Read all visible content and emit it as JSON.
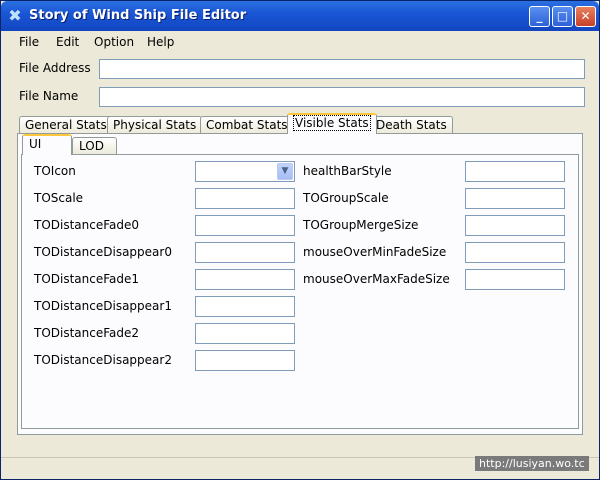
{
  "window": {
    "title": "Story of Wind Ship File Editor",
    "icon": "x-logo-icon",
    "buttons": {
      "minimize": "_",
      "maximize": "□",
      "close": "✕"
    }
  },
  "menu": {
    "items": [
      "File",
      "Edit",
      "Option",
      "Help"
    ]
  },
  "file": {
    "address_label": "File Address",
    "address_value": "",
    "name_label": "File Name",
    "name_value": ""
  },
  "tabs": [
    {
      "label": "General Stats",
      "active": false
    },
    {
      "label": "Physical Stats",
      "active": false
    },
    {
      "label": "Combat Stats",
      "active": false
    },
    {
      "label": "Visible Stats",
      "active": true
    },
    {
      "label": "Death Stats",
      "active": false
    }
  ],
  "subtabs": [
    {
      "label": "UI",
      "active": true
    },
    {
      "label": "LOD",
      "active": false
    }
  ],
  "left_fields": [
    {
      "label": "TOIcon",
      "value": "",
      "type": "combo"
    },
    {
      "label": "TOScale",
      "value": ""
    },
    {
      "label": "TODistanceFade0",
      "value": ""
    },
    {
      "label": "TODistanceDisappear0",
      "value": ""
    },
    {
      "label": "TODistanceFade1",
      "value": ""
    },
    {
      "label": "TODistanceDisappear1",
      "value": ""
    },
    {
      "label": "TODistanceFade2",
      "value": ""
    },
    {
      "label": "TODistanceDisappear2",
      "value": ""
    }
  ],
  "right_fields": [
    {
      "label": "healthBarStyle",
      "value": ""
    },
    {
      "label": "TOGroupScale",
      "value": ""
    },
    {
      "label": "TOGroupMergeSize",
      "value": ""
    },
    {
      "label": "mouseOverMinFadeSize",
      "value": ""
    },
    {
      "label": "mouseOverMaxFadeSize",
      "value": ""
    }
  ],
  "watermark": "http://lusiyan.wo.tc",
  "colors": {
    "titlebar": "#1a56d6",
    "tab_highlight": "#ffc83c",
    "window_bg": "#ece9d8"
  }
}
